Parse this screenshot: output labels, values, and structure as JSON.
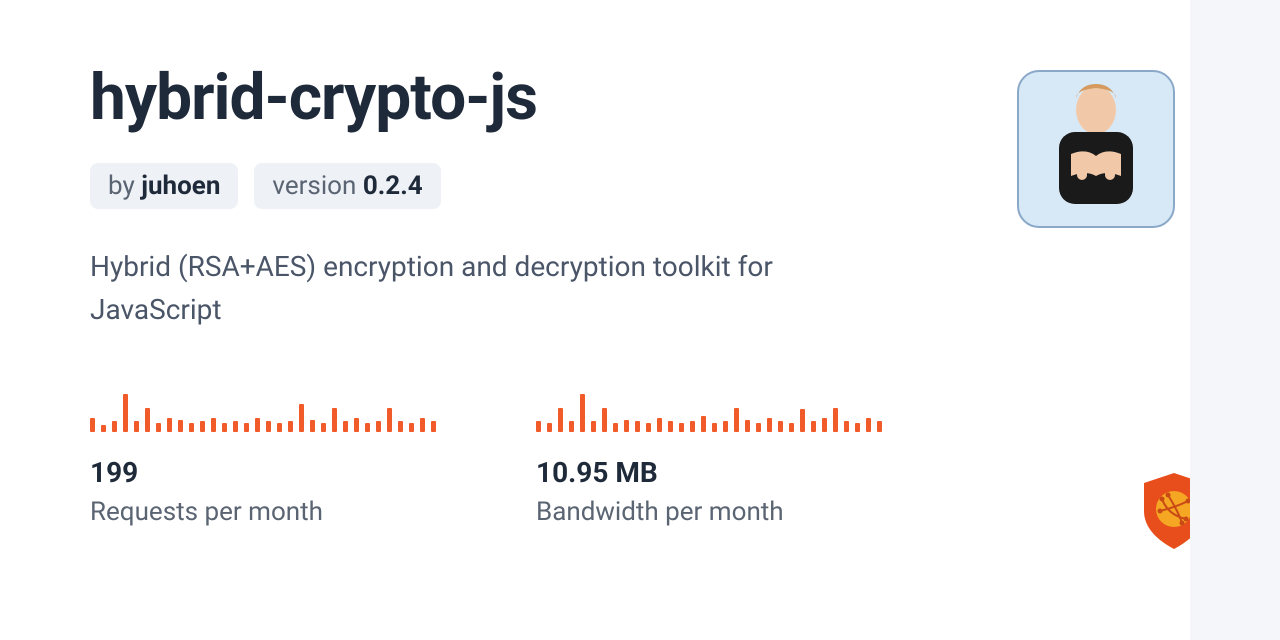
{
  "package": {
    "name": "hybrid-crypto-js",
    "author_prefix": "by ",
    "author": "juhoen",
    "version_prefix": "version ",
    "version": "0.2.4",
    "description": "Hybrid (RSA+AES) encryption and decryption toolkit for JavaScript"
  },
  "stats": {
    "requests": {
      "value": "199",
      "label": "Requests per month",
      "spark": [
        8,
        4,
        6,
        22,
        6,
        14,
        5,
        8,
        7,
        5,
        6,
        8,
        5,
        6,
        5,
        8,
        6,
        5,
        6,
        16,
        7,
        5,
        14,
        6,
        8,
        5,
        6,
        14,
        6,
        5,
        8,
        6
      ]
    },
    "bandwidth": {
      "value": "10.95 MB",
      "label": "Bandwidth per month",
      "spark": [
        6,
        5,
        14,
        6,
        22,
        6,
        14,
        5,
        7,
        6,
        5,
        8,
        6,
        5,
        6,
        9,
        5,
        6,
        14,
        7,
        5,
        8,
        6,
        5,
        13,
        6,
        8,
        14,
        6,
        5,
        8,
        6
      ]
    }
  },
  "colors": {
    "accent": "#f15a29"
  }
}
